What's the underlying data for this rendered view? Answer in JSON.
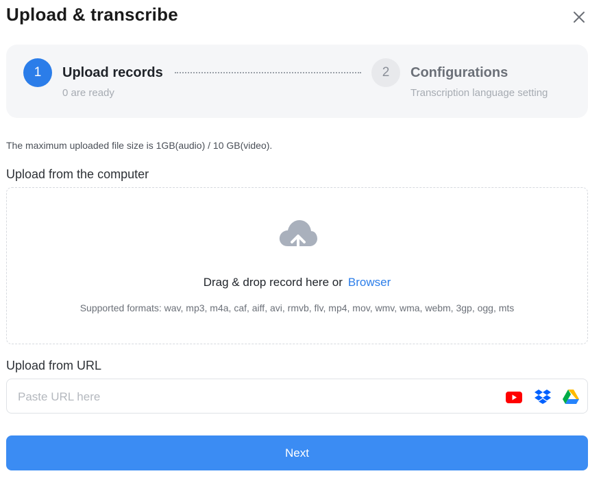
{
  "header": {
    "title": "Upload & transcribe",
    "close_icon": "close-icon"
  },
  "stepper": {
    "steps": [
      {
        "number": "1",
        "title": "Upload records",
        "subtitle": "0 are ready",
        "active": true
      },
      {
        "number": "2",
        "title": "Configurations",
        "subtitle": "Transcription language setting",
        "active": false
      }
    ]
  },
  "upload": {
    "limit_text": "The maximum uploaded file size is 1GB(audio) / 10 GB(video).",
    "computer_label": "Upload from the computer",
    "drop_text": "Drag & drop record here or",
    "browse_label": "Browser",
    "formats_text": "Supported formats: wav, mp3, m4a, caf, aiff, avi, rmvb, flv, mp4, mov, wmv, wma, webm, 3gp, ogg, mts",
    "upload_icon": "cloud-upload-icon"
  },
  "url": {
    "label": "Upload from URL",
    "placeholder": "Paste URL here",
    "value": "",
    "sources": [
      "youtube-icon",
      "dropbox-icon",
      "google-drive-icon"
    ]
  },
  "footer": {
    "next_label": "Next"
  },
  "colors": {
    "accent": "#2b7de9",
    "next_button": "#3b8cf3",
    "stepper_bg": "#f5f6f8"
  }
}
